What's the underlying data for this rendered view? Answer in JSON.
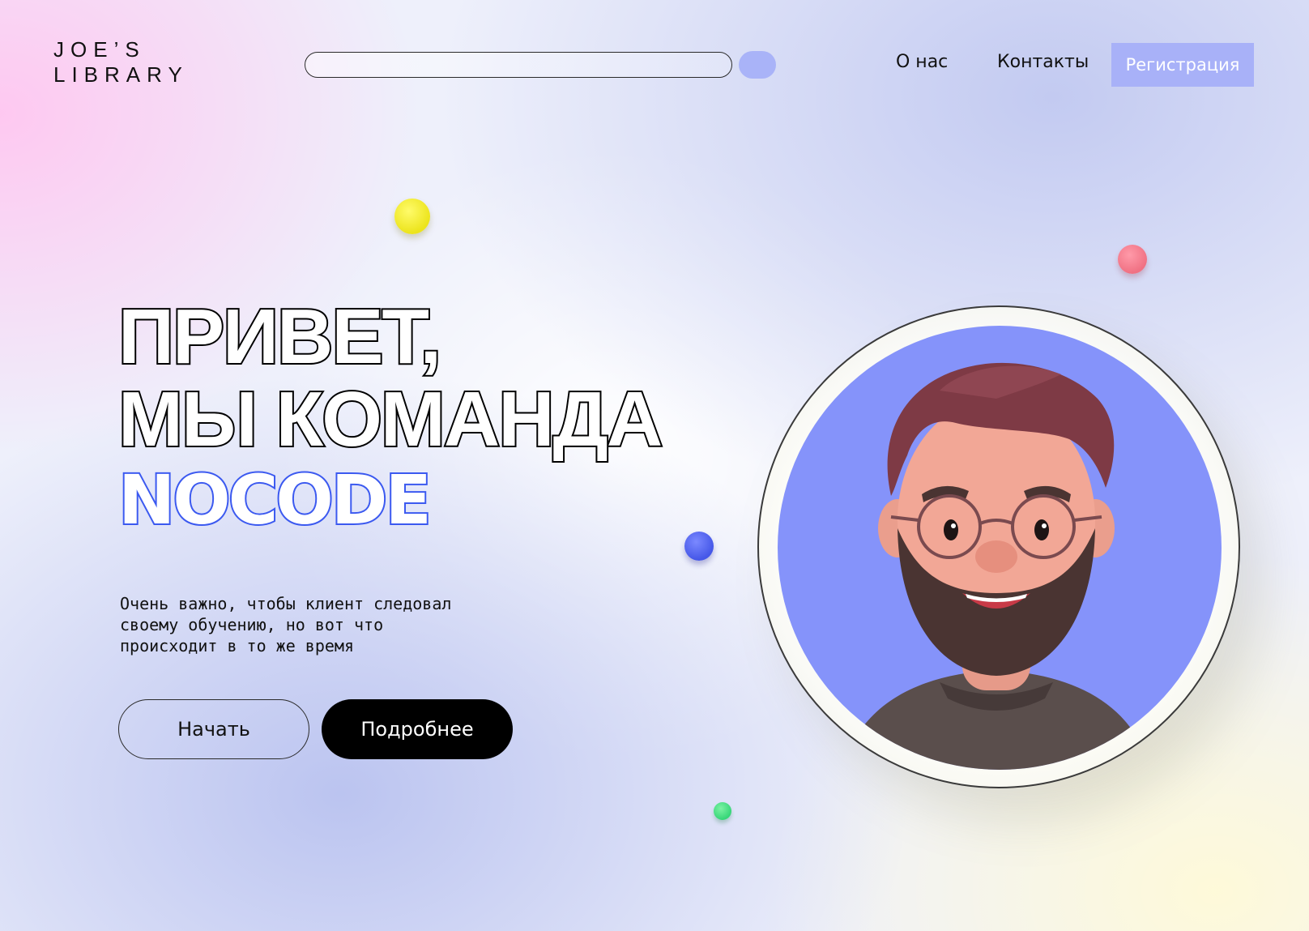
{
  "header": {
    "logo_line1": "JOE’S",
    "logo_line2": "LIBRARY",
    "search": {
      "value": "",
      "placeholder": ""
    },
    "nav": [
      {
        "label": "О нас"
      },
      {
        "label": "Контакты"
      }
    ],
    "register_label": "Регистрация"
  },
  "hero": {
    "line1": "ПРИВЕТ,",
    "line2": "МЫ КОМАНДА",
    "line3": "NOCODE",
    "description": "Очень важно, чтобы клиент следовал своему обучению, но вот что происходит в то же время",
    "start_label": "Начать",
    "more_label": "Подробнее"
  },
  "colors": {
    "accent": "#a8b1f8",
    "nocode_outline": "#3b59f0",
    "avatar_bg": "#8593fa"
  },
  "icons": [
    "search-button-icon",
    "avatar-illustration"
  ]
}
